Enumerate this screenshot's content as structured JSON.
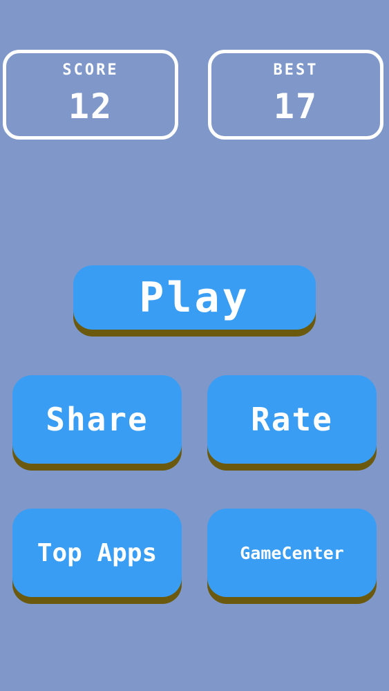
{
  "scoreboard": {
    "score_label": "SCORE",
    "score_value": "12",
    "best_label": "BEST",
    "best_value": "17"
  },
  "menu": {
    "play_label": "Play",
    "share_label": "Share",
    "rate_label": "Rate",
    "top_apps_label": "Top Apps",
    "gamecenter_label": "GameCenter"
  },
  "colors": {
    "background": "#7f98c9",
    "button": "#3a9df4",
    "button_shadow": "#6b5a0e",
    "text": "#ffffff"
  }
}
